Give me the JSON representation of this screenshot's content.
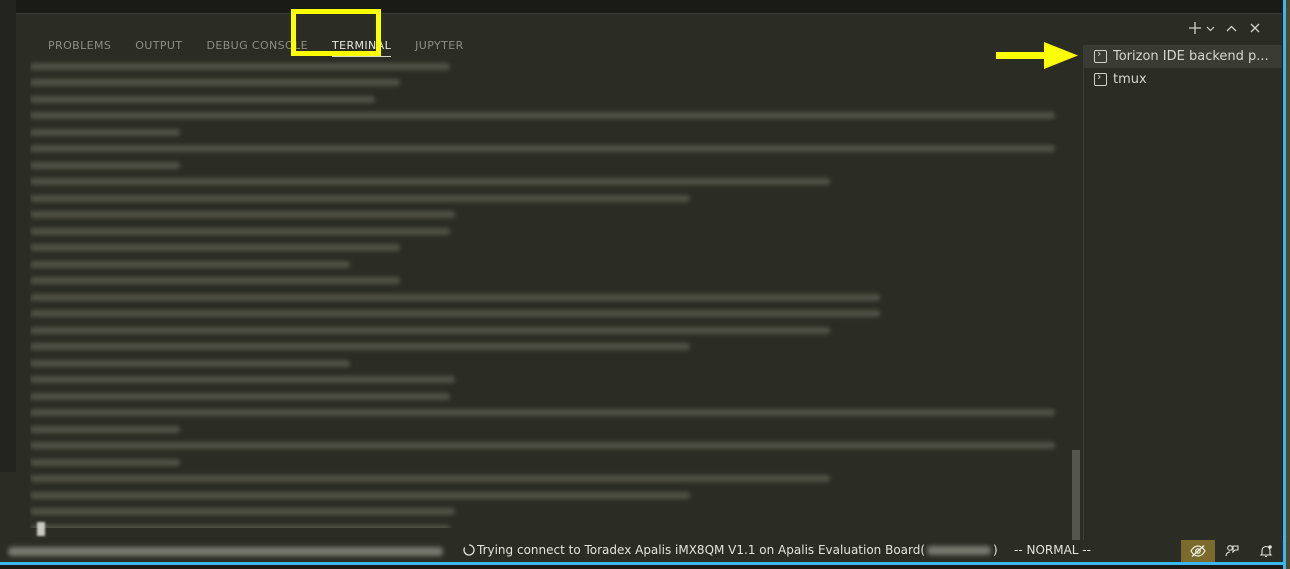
{
  "panel": {
    "tabs": [
      {
        "label": "PROBLEMS"
      },
      {
        "label": "OUTPUT"
      },
      {
        "label": "DEBUG CONSOLE"
      },
      {
        "label": "TERMINAL"
      },
      {
        "label": "JUPYTER"
      }
    ],
    "active_tab": "TERMINAL",
    "actions": [
      "plus-icon",
      "chevron-down-icon",
      "chevron-up-icon",
      "close-icon"
    ]
  },
  "terminal_list": {
    "items": [
      {
        "label": "Torizon IDE backend p..."
      },
      {
        "label": "tmux"
      }
    ],
    "selected": 0
  },
  "status_bar": {
    "connection_message_prefix": "Trying connect to Toradex Apalis iMX8QM V1.1 on Apalis Evaluation Board(",
    "connection_message_suffix": ")",
    "mode": "-- NORMAL --",
    "icons": [
      "eye-off-icon",
      "feedback-icon",
      "bell-icon"
    ]
  },
  "colors": {
    "highlight": "#fbff00",
    "accent": "#3ab7f0",
    "panel_bg": "#2b2d25"
  }
}
